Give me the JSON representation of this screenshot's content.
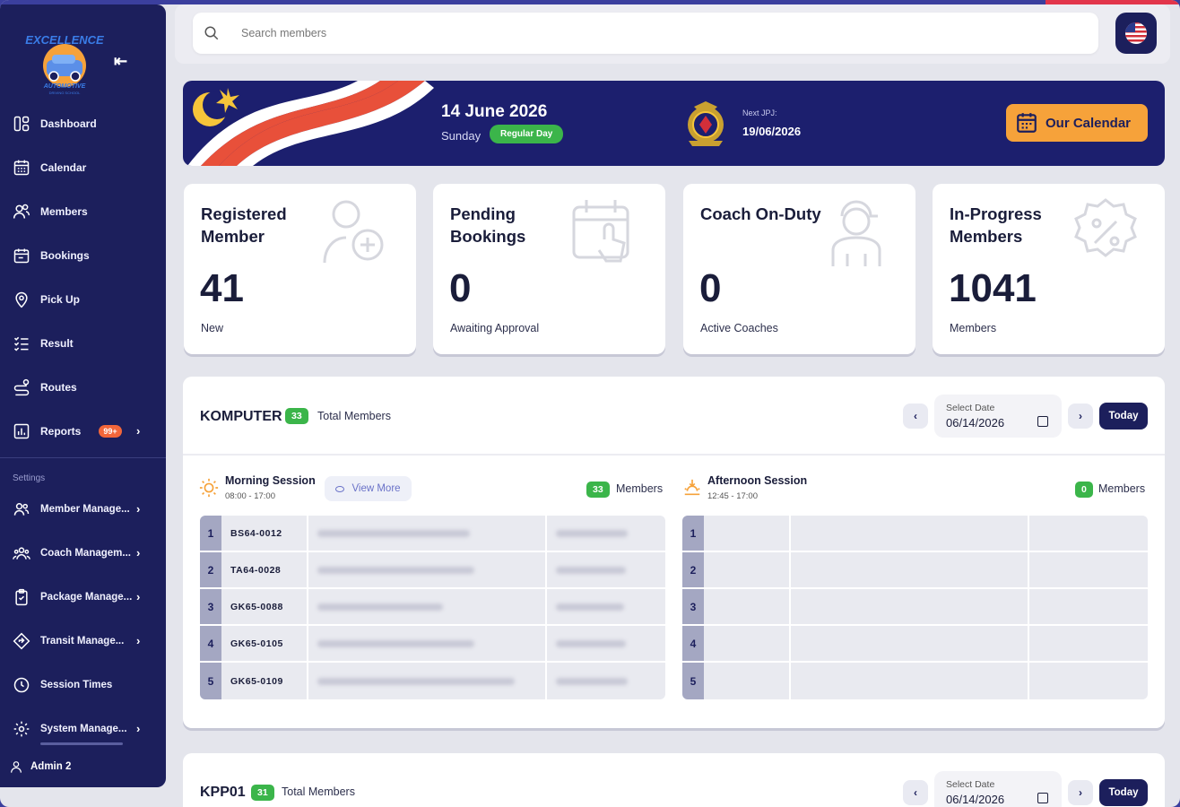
{
  "sidebar": {
    "collapse_icon": "collapse-left-icon",
    "logo_text": "EXCELLENCE AUTOMOTIVE DRIVING SCHOOL",
    "items": [
      {
        "label": "Dashboard",
        "icon": "dashboard-icon"
      },
      {
        "label": "Calendar",
        "icon": "calendar-icon"
      },
      {
        "label": "Members",
        "icon": "members-icon"
      },
      {
        "label": "Bookings",
        "icon": "bookings-icon"
      },
      {
        "label": "Pick Up",
        "icon": "location-pin-icon"
      },
      {
        "label": "Result",
        "icon": "checklist-icon"
      },
      {
        "label": "Routes",
        "icon": "route-icon"
      },
      {
        "label": "Reports",
        "icon": "reports-icon",
        "badge": "99+"
      }
    ],
    "settings_label": "Settings",
    "settings_items": [
      {
        "label": "Member Manage...",
        "icon": "user-group-icon"
      },
      {
        "label": "Coach Managem...",
        "icon": "coach-group-icon"
      },
      {
        "label": "Package Manage...",
        "icon": "clipboard-icon"
      },
      {
        "label": "Transit Manage...",
        "icon": "transit-icon"
      },
      {
        "label": "Session Times",
        "icon": "clock-icon"
      },
      {
        "label": "System Manage...",
        "icon": "gear-icon"
      }
    ],
    "user": "Admin 2"
  },
  "search": {
    "placeholder": "Search members"
  },
  "banner": {
    "date": "14 June 2026",
    "day": "Sunday",
    "day_type": "Regular Day",
    "next_label": "Next JPJ:",
    "next_date": "19/06/2026",
    "calendar_button": "Our Calendar"
  },
  "stats": [
    {
      "title": "Registered Member",
      "value": "41",
      "sub": "New",
      "icon": "add-user-icon"
    },
    {
      "title": "Pending Bookings",
      "value": "0",
      "sub": "Awaiting Approval",
      "icon": "calendar-touch-icon"
    },
    {
      "title": "Coach On-Duty",
      "value": "0",
      "sub": "Active Coaches",
      "icon": "coach-icon"
    },
    {
      "title": "In-Progress Members",
      "value": "1041",
      "sub": "Members",
      "icon": "percent-badge-icon"
    }
  ],
  "class_panel": {
    "name": "KOMPUTER",
    "count": "33",
    "total_label": "Total Members",
    "date_label": "Select Date",
    "date_value": "06/14/2026",
    "today_label": "Today",
    "morning": {
      "title": "Morning Session",
      "time": "08:00 - 17:00",
      "view_more": "View More",
      "count": "33",
      "members_label": "Members"
    },
    "afternoon": {
      "title": "Afternoon Session",
      "time": "12:45 - 17:00",
      "count": "0",
      "members_label": "Members"
    },
    "morning_rows": [
      {
        "n": "1",
        "code": "BS64-0012"
      },
      {
        "n": "2",
        "code": "TA64-0028"
      },
      {
        "n": "3",
        "code": "GK65-0088"
      },
      {
        "n": "4",
        "code": "GK65-0105"
      },
      {
        "n": "5",
        "code": "GK65-0109"
      }
    ],
    "afternoon_rows": [
      "1",
      "2",
      "3",
      "4",
      "5"
    ]
  },
  "class_panel_2": {
    "name": "KPP01",
    "count": "31",
    "total_label": "Total Members",
    "date_label": "Select Date",
    "date_value": "06/14/2026",
    "today_label": "Today"
  },
  "colors": {
    "navy": "#1c1f5c",
    "accent_orange": "#f6a23a",
    "green": "#3bb54a",
    "badge_orange": "#f2663a"
  }
}
